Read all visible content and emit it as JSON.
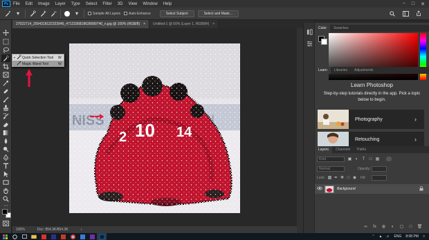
{
  "menubar": {
    "logo": "Ps",
    "items": [
      "File",
      "Edit",
      "Image",
      "Layer",
      "Type",
      "Select",
      "Filter",
      "3D",
      "View",
      "Window",
      "Help"
    ],
    "controls": [
      "−",
      "□",
      "✕"
    ]
  },
  "options": {
    "sample_all_layers": "Sample All Layers",
    "auto_enhance": "Auto-Enhance",
    "select_subject": "Select Subject",
    "select_and_mask": "Select and Mask..."
  },
  "tabs": [
    {
      "label": "27022714_2004318122323945_4712336818639580740_n.jpg @ 100% (RGB/8)",
      "close": "×"
    },
    {
      "label": "Untitled-1 @ 50% (Layer 1, RGB/8#)",
      "close": "×"
    }
  ],
  "flyout": {
    "items": [
      {
        "mark": "▪",
        "label": "Quick Selection Tool",
        "key": "W"
      },
      {
        "mark": "",
        "label": "Magic Wand Tool",
        "key": "W"
      }
    ]
  },
  "status": {
    "zoom": "100%",
    "doc": "Doc: 854.3K/854.3K",
    "arrow": "›"
  },
  "color_panel": {
    "tabs": [
      "Color",
      "Swatches"
    ],
    "fg_color": "#000000",
    "bg_color": "#ffffff"
  },
  "learn_panel": {
    "tabs": [
      "Learn",
      "Libraries",
      "Adjustments"
    ],
    "title": "Learn Photoshop",
    "subtitle": "Step-by-step tutorials directly in the app. Pick a topic below to begin.",
    "cards": [
      {
        "label": "Photography"
      },
      {
        "label": "Retouching"
      }
    ]
  },
  "layers_panel": {
    "tabs": [
      "Layers",
      "Channels",
      "Paths"
    ],
    "kind": "Kind",
    "blend": "Normal",
    "opacity_label": "Opacity:",
    "lock_label": "Lock:",
    "fill_label": "Fill:",
    "layer_name": "Background"
  },
  "taskbar": {
    "lang": "ENG",
    "time": "8:08 PM"
  },
  "colors": {
    "accent": "#31a8ff",
    "red_arrow": "#e8143c"
  }
}
